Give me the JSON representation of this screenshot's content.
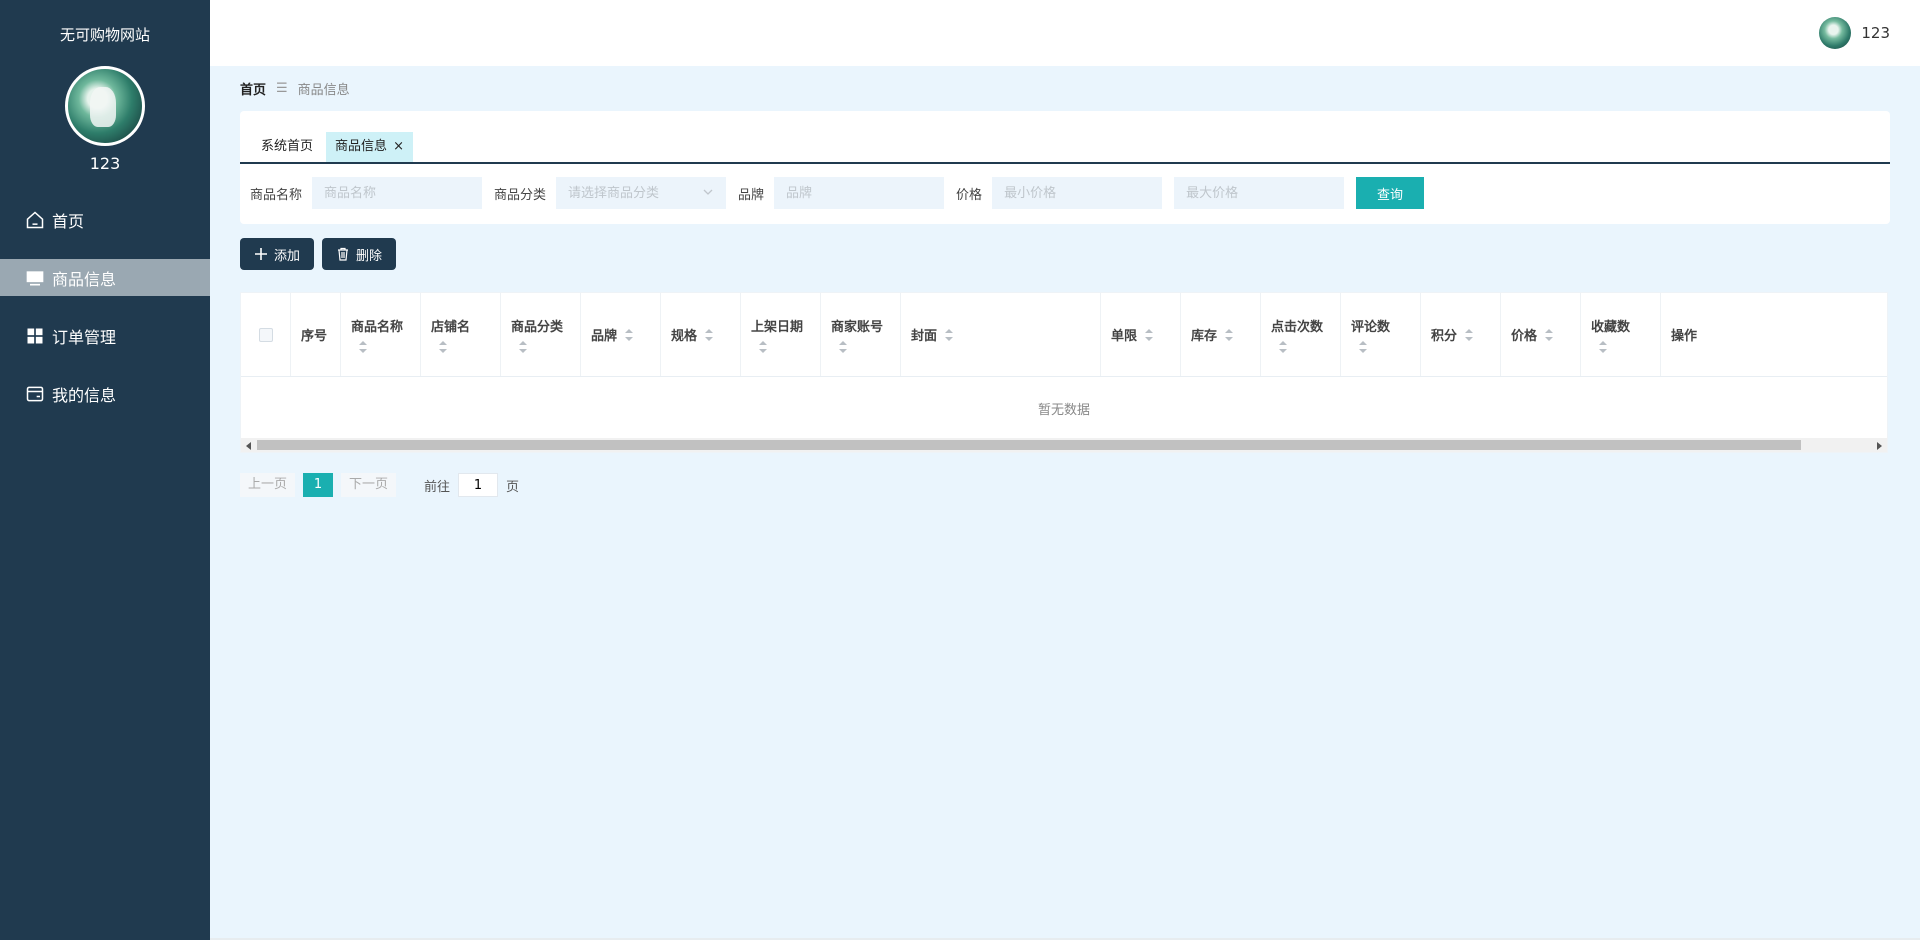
{
  "sidebar": {
    "brand": "无可购物网站",
    "username": "123",
    "items": [
      {
        "label": "首页",
        "icon": "home-icon",
        "active": false
      },
      {
        "label": "商品信息",
        "icon": "monitor-icon",
        "active": true
      },
      {
        "label": "订单管理",
        "icon": "grid-icon",
        "active": false
      },
      {
        "label": "我的信息",
        "icon": "id-card-icon",
        "active": false
      }
    ]
  },
  "header": {
    "username": "123"
  },
  "breadcrumb": {
    "home": "首页",
    "separator": "☰",
    "current": "商品信息"
  },
  "tabs": [
    {
      "label": "系统首页",
      "active": false
    },
    {
      "label": "商品信息",
      "active": true,
      "closable": true,
      "close_glyph": "×"
    }
  ],
  "filters": {
    "name_label": "商品名称",
    "name_placeholder": "商品名称",
    "category_label": "商品分类",
    "category_placeholder": "请选择商品分类",
    "brand_label": "品牌",
    "brand_placeholder": "品牌",
    "price_label": "价格",
    "price_min_placeholder": "最小价格",
    "price_max_placeholder": "最大价格",
    "query_label": "查询"
  },
  "actions": {
    "add_label": "添加",
    "delete_label": "删除"
  },
  "table": {
    "columns": [
      "序号",
      "商品名称",
      "店铺名",
      "商品分类",
      "品牌",
      "规格",
      "上架日期",
      "商家账号",
      "封面",
      "单限",
      "库存",
      "点击次数",
      "评论数",
      "积分",
      "价格",
      "收藏数",
      "操作"
    ],
    "empty_text": "暂无数据"
  },
  "pagination": {
    "prev": "上一页",
    "current": "1",
    "next": "下一页",
    "goto": "前往",
    "goto_value": "1",
    "unit": "页"
  },
  "colors": {
    "sidebar": "#203a4f",
    "accent": "#1aafb0",
    "background": "#eaf5fd",
    "active_tab": "#cef1f7"
  }
}
